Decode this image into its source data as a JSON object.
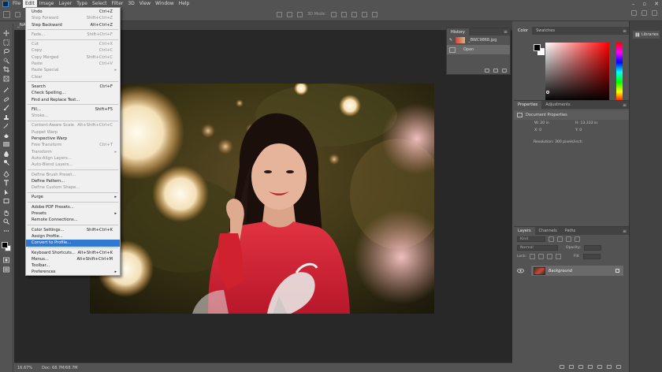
{
  "menubar": {
    "items": [
      "File",
      "Edit",
      "Image",
      "Layer",
      "Type",
      "Select",
      "Filter",
      "3D",
      "View",
      "Window",
      "Help"
    ],
    "active": "Edit"
  },
  "options": {
    "mode_3d": "3D Mode:"
  },
  "document": {
    "tab": "_NAT",
    "zoom": "16.67%",
    "doc_size": "Doc: 68.7M/68.7M"
  },
  "edit_menu": [
    {
      "label": "Undo",
      "shortcut": "Ctrl+Z",
      "disabled": false
    },
    {
      "label": "Step Forward",
      "shortcut": "Shift+Ctrl+Z",
      "disabled": true
    },
    {
      "label": "Step Backward",
      "shortcut": "Alt+Ctrl+Z",
      "disabled": false
    },
    {
      "sep": true
    },
    {
      "label": "Fade...",
      "shortcut": "Shift+Ctrl+F",
      "disabled": true
    },
    {
      "sep": true
    },
    {
      "label": "Cut",
      "shortcut": "Ctrl+X",
      "disabled": true
    },
    {
      "label": "Copy",
      "shortcut": "Ctrl+C",
      "disabled": true
    },
    {
      "label": "Copy Merged",
      "shortcut": "Shift+Ctrl+C",
      "disabled": true
    },
    {
      "label": "Paste",
      "shortcut": "Ctrl+V",
      "disabled": true
    },
    {
      "label": "Paste Special",
      "shortcut": "",
      "arrow": true,
      "disabled": true
    },
    {
      "label": "Clear",
      "shortcut": "",
      "disabled": true
    },
    {
      "sep": true
    },
    {
      "label": "Search",
      "shortcut": "Ctrl+F",
      "disabled": false
    },
    {
      "label": "Check Spelling...",
      "shortcut": "",
      "disabled": false
    },
    {
      "label": "Find and Replace Text...",
      "shortcut": "",
      "disabled": false
    },
    {
      "sep": true
    },
    {
      "label": "Fill...",
      "shortcut": "Shift+F5",
      "disabled": false
    },
    {
      "label": "Stroke...",
      "shortcut": "",
      "disabled": true
    },
    {
      "sep": true
    },
    {
      "label": "Content-Aware Scale",
      "shortcut": "Alt+Shift+Ctrl+C",
      "disabled": true
    },
    {
      "label": "Puppet Warp",
      "shortcut": "",
      "disabled": true
    },
    {
      "label": "Perspective Warp",
      "shortcut": "",
      "disabled": false
    },
    {
      "label": "Free Transform",
      "shortcut": "Ctrl+T",
      "disabled": true
    },
    {
      "label": "Transform",
      "shortcut": "",
      "arrow": true,
      "disabled": true
    },
    {
      "label": "Auto-Align Layers...",
      "shortcut": "",
      "disabled": true
    },
    {
      "label": "Auto-Blend Layers...",
      "shortcut": "",
      "disabled": true
    },
    {
      "sep": true
    },
    {
      "label": "Define Brush Preset...",
      "shortcut": "",
      "disabled": true
    },
    {
      "label": "Define Pattern...",
      "shortcut": "",
      "disabled": false
    },
    {
      "label": "Define Custom Shape...",
      "shortcut": "",
      "disabled": true
    },
    {
      "sep": true
    },
    {
      "label": "Purge",
      "shortcut": "",
      "arrow": true,
      "disabled": false
    },
    {
      "sep": true
    },
    {
      "label": "Adobe PDF Presets...",
      "shortcut": "",
      "disabled": false
    },
    {
      "label": "Presets",
      "shortcut": "",
      "arrow": true,
      "disabled": false
    },
    {
      "label": "Remote Connections...",
      "shortcut": "",
      "disabled": false
    },
    {
      "sep": true
    },
    {
      "label": "Color Settings...",
      "shortcut": "Shift+Ctrl+K",
      "disabled": false
    },
    {
      "label": "Assign Profile...",
      "shortcut": "",
      "disabled": false
    },
    {
      "label": "Convert to Profile...",
      "shortcut": "",
      "disabled": false,
      "highlight": true
    },
    {
      "sep": true
    },
    {
      "label": "Keyboard Shortcuts...",
      "shortcut": "Alt+Shift+Ctrl+K",
      "disabled": false
    },
    {
      "label": "Menus...",
      "shortcut": "Alt+Shift+Ctrl+M",
      "disabled": false
    },
    {
      "label": "Toolbar...",
      "shortcut": "",
      "disabled": false
    },
    {
      "label": "Preferences",
      "shortcut": "",
      "arrow": true,
      "disabled": false
    }
  ],
  "history": {
    "tab": "History",
    "snapshot": "_BWC9868.jpg",
    "state": "Open"
  },
  "color_panel": {
    "tabs": [
      "Color",
      "Swatches"
    ],
    "foreground": "#000000",
    "background": "#ffffff"
  },
  "properties": {
    "tabs": [
      "Properties",
      "Adjustments"
    ],
    "title": "Document Properties",
    "w": "W:  20 in",
    "h": "H:  13.333 in",
    "x": "X:  0",
    "y": "Y:  0",
    "resolution": "Resolution: 300 pixels/inch"
  },
  "layers": {
    "tabs": [
      "Layers",
      "Channels",
      "Paths"
    ],
    "kind": "Kind",
    "blend": "Normal",
    "opacity_label": "Opacity:",
    "lock_label": "Lock:",
    "fill_label": "Fill:",
    "layer_name": "Background"
  },
  "libraries": {
    "label": "Libraries"
  },
  "colors": {
    "menu_highlight": "#3178d4",
    "dress_red": "#d0222e",
    "ui_panel": "#535353"
  }
}
